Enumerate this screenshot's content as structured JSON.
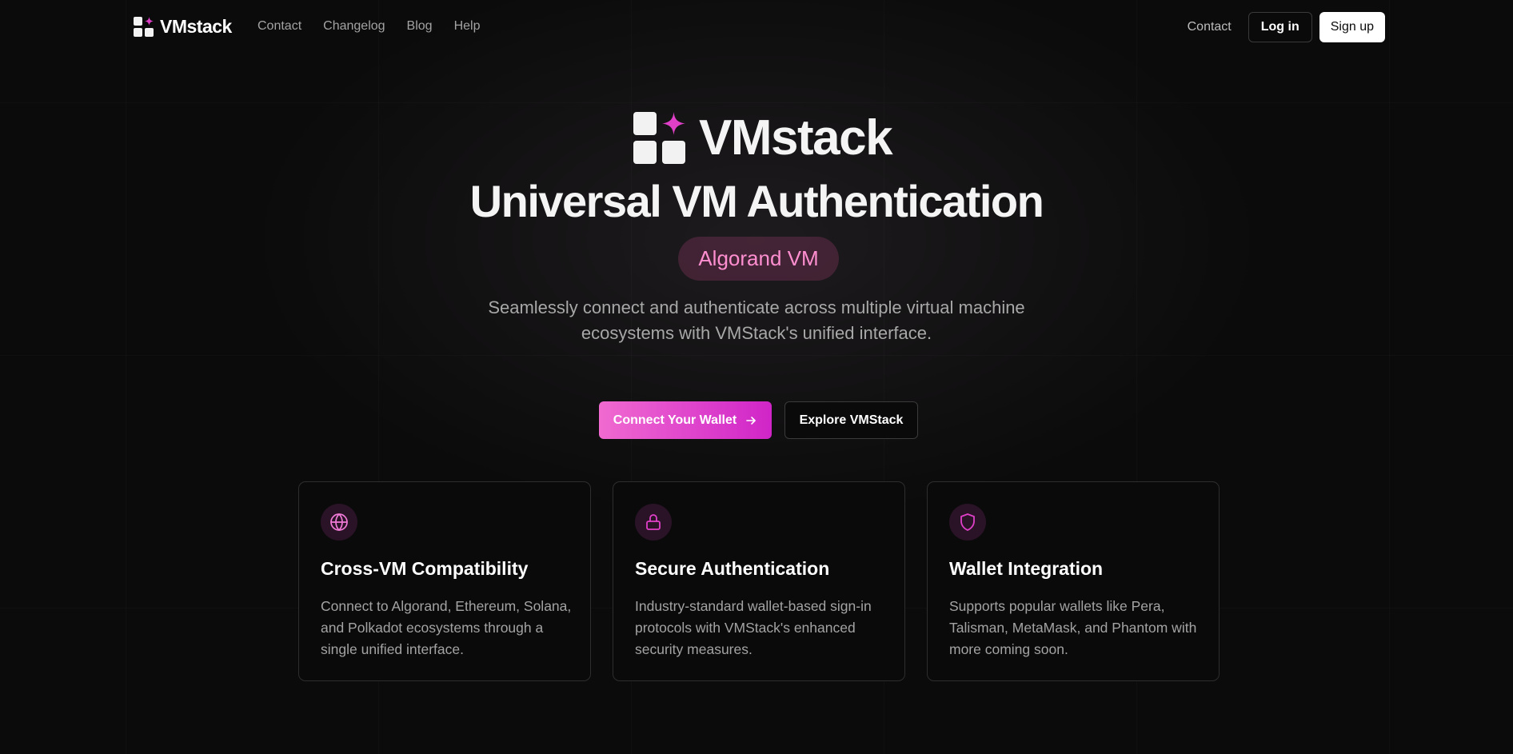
{
  "nav": {
    "brand": "VMstack",
    "links": [
      "Contact",
      "Changelog",
      "Blog",
      "Help"
    ],
    "contact": "Contact",
    "login": "Log in",
    "signup": "Sign up"
  },
  "hero": {
    "brand": "VMstack",
    "title": "Universal VM Authentication",
    "pill": "Algorand VM",
    "subtitle_line1": "Seamlessly connect and authenticate across multiple virtual machine",
    "subtitle_line2": "ecosystems with VMStack's unified interface.",
    "cta_primary": "Connect Your Wallet",
    "cta_secondary": "Explore VMStack"
  },
  "features": [
    {
      "icon": "globe-icon",
      "title": "Cross-VM Compatibility",
      "description": "Connect to Algorand, Ethereum, Solana, and Polkadot ecosystems through a single unified interface."
    },
    {
      "icon": "lock-icon",
      "title": "Secure Authentication",
      "description": "Industry-standard wallet-based sign-in protocols with VMStack's enhanced security measures."
    },
    {
      "icon": "shield-icon",
      "title": "Wallet Integration",
      "description": "Supports popular wallets like Pera, Talisman, MetaMask, and Phantom with more coming soon."
    }
  ],
  "colors": {
    "background": "#0b0b0b",
    "accent": "#e040c8",
    "pill_text": "#ff8fd0",
    "icon_pink": "#f07ad6"
  }
}
